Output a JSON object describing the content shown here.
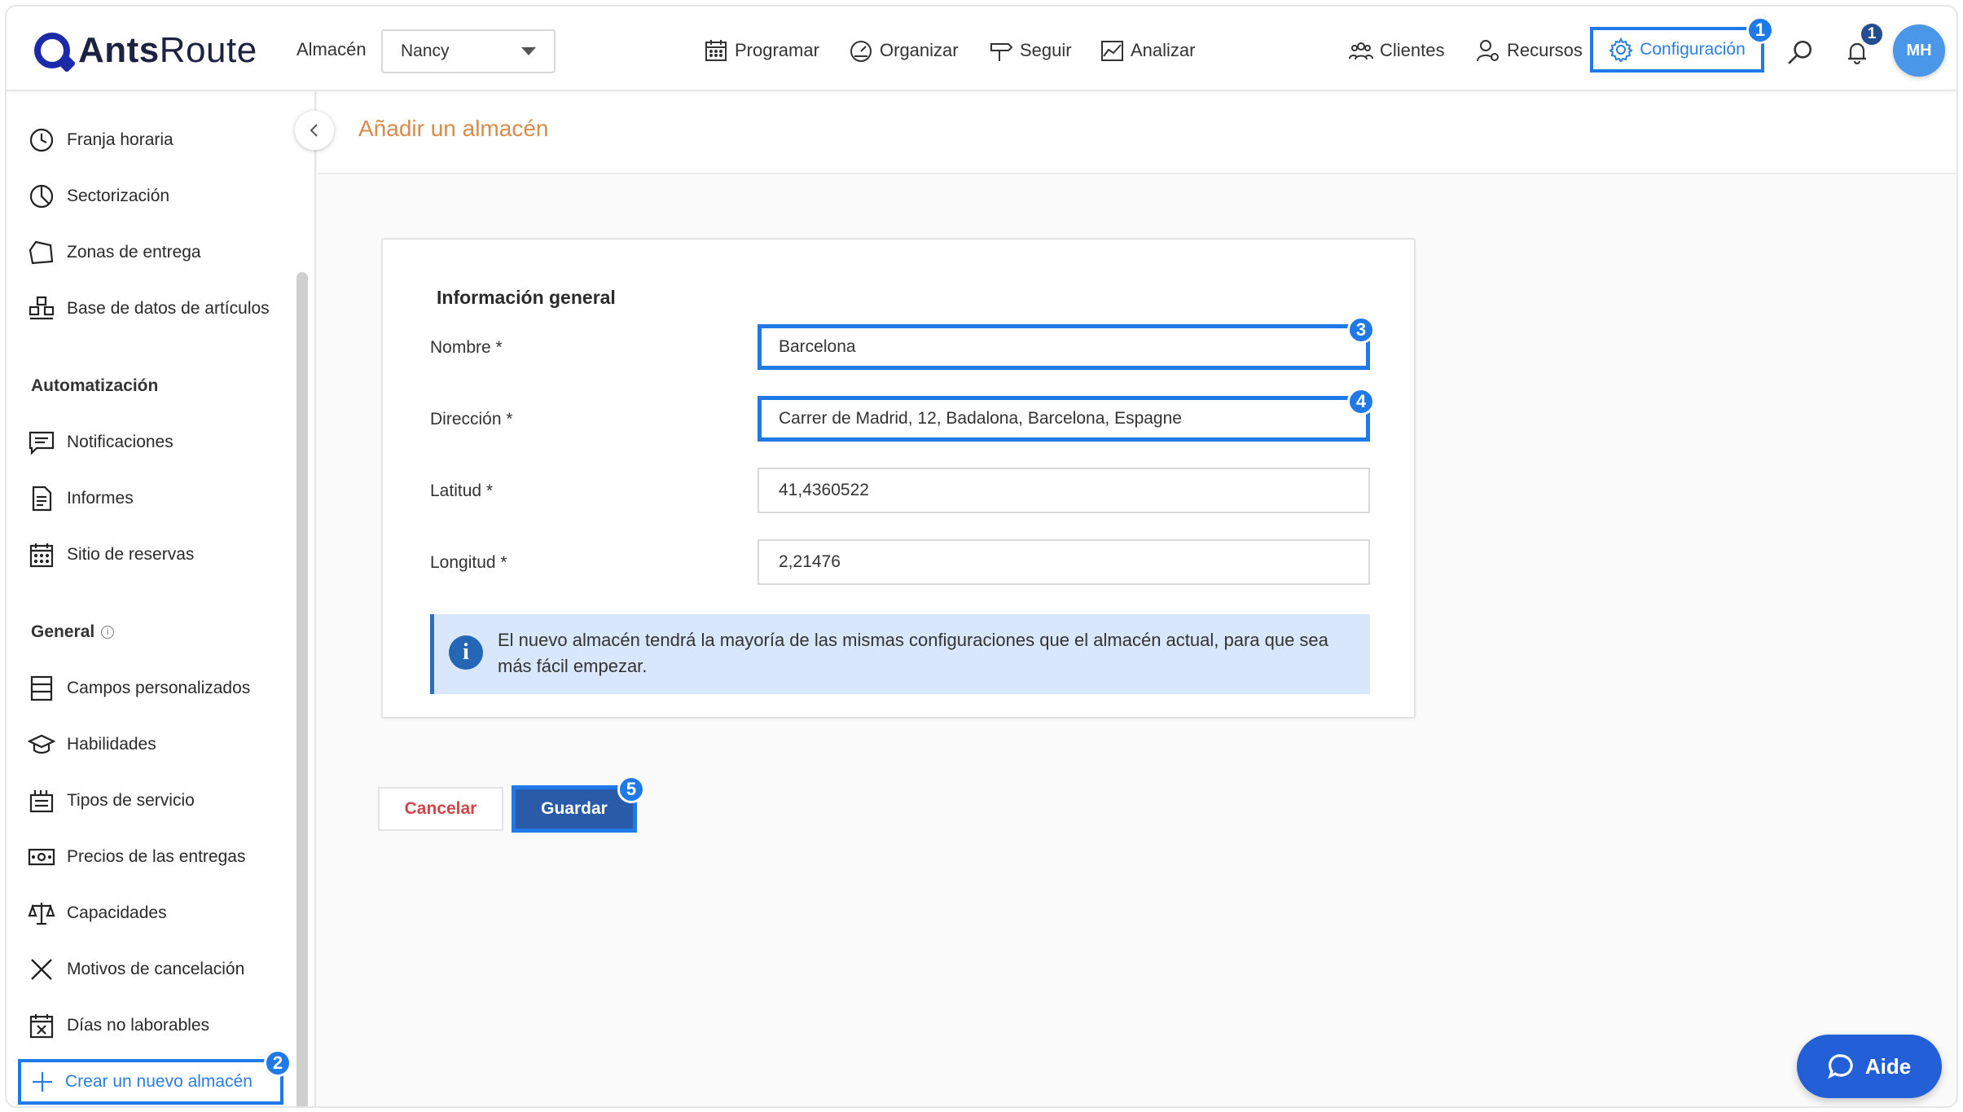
{
  "app": {
    "logo_bold": "Ants",
    "logo_light": "Route"
  },
  "header": {
    "warehouse_label": "Almacén",
    "warehouse_value": "Nancy",
    "nav": [
      {
        "label": "Programar",
        "icon": "calendar-icon"
      },
      {
        "label": "Organizar",
        "icon": "gauge-icon"
      },
      {
        "label": "Seguir",
        "icon": "signpost-icon"
      },
      {
        "label": "Analizar",
        "icon": "chart-icon"
      }
    ],
    "clients_label": "Clientes",
    "resources_label": "Recursos",
    "config_label": "Configuración",
    "notifications_count": "1",
    "avatar_initials": "MH"
  },
  "sidebar": {
    "items_top": [
      {
        "label": "Franja horaria",
        "icon": "clock-icon"
      },
      {
        "label": "Sectorización",
        "icon": "pie-icon"
      },
      {
        "label": "Zonas de entrega",
        "icon": "polygon-icon"
      },
      {
        "label": "Base de datos de artículos",
        "icon": "boxes-icon"
      }
    ],
    "section_automation": "Automatización",
    "items_automation": [
      {
        "label": "Notificaciones",
        "icon": "message-icon"
      },
      {
        "label": "Informes",
        "icon": "document-icon"
      },
      {
        "label": "Sitio de reservas",
        "icon": "calendar-grid-icon"
      }
    ],
    "section_general": "General",
    "items_general": [
      {
        "label": "Campos personalizados",
        "icon": "fields-icon"
      },
      {
        "label": "Habilidades",
        "icon": "graduation-icon"
      },
      {
        "label": "Tipos de servicio",
        "icon": "service-icon"
      },
      {
        "label": "Precios de las entregas",
        "icon": "banknote-icon"
      },
      {
        "label": "Capacidades",
        "icon": "scale-icon"
      },
      {
        "label": "Motivos de cancelación",
        "icon": "x-icon"
      },
      {
        "label": "Días no laborables",
        "icon": "calendar-x-icon"
      }
    ],
    "new_warehouse": "Crear un nuevo almacén"
  },
  "main": {
    "page_title": "Añadir un almacén",
    "card_title": "Información general",
    "fields": {
      "name_label": "Nombre *",
      "name_value": "Barcelona",
      "address_label": "Dirección *",
      "address_value": "Carrer de Madrid, 12, Badalona, Barcelona, Espagne",
      "lat_label": "Latitud *",
      "lat_value": "41,4360522",
      "lng_label": "Longitud *",
      "lng_value": "2,21476"
    },
    "info_text": "El nuevo almacén tendrá la mayoría de las mismas configuraciones que el almacén actual, para que sea más fácil empezar.",
    "cancel_label": "Cancelar",
    "save_label": "Guardar"
  },
  "annotations": [
    "1",
    "2",
    "3",
    "4",
    "5"
  ],
  "help": {
    "label": "Aide"
  },
  "colors": {
    "accent": "#1f7ae8",
    "brand": "#1a2aa8",
    "title_orange": "#d98b4a",
    "save_blue": "#2a5ba8",
    "cancel_red": "#d0454a",
    "info_bg": "#d8e7fb"
  }
}
